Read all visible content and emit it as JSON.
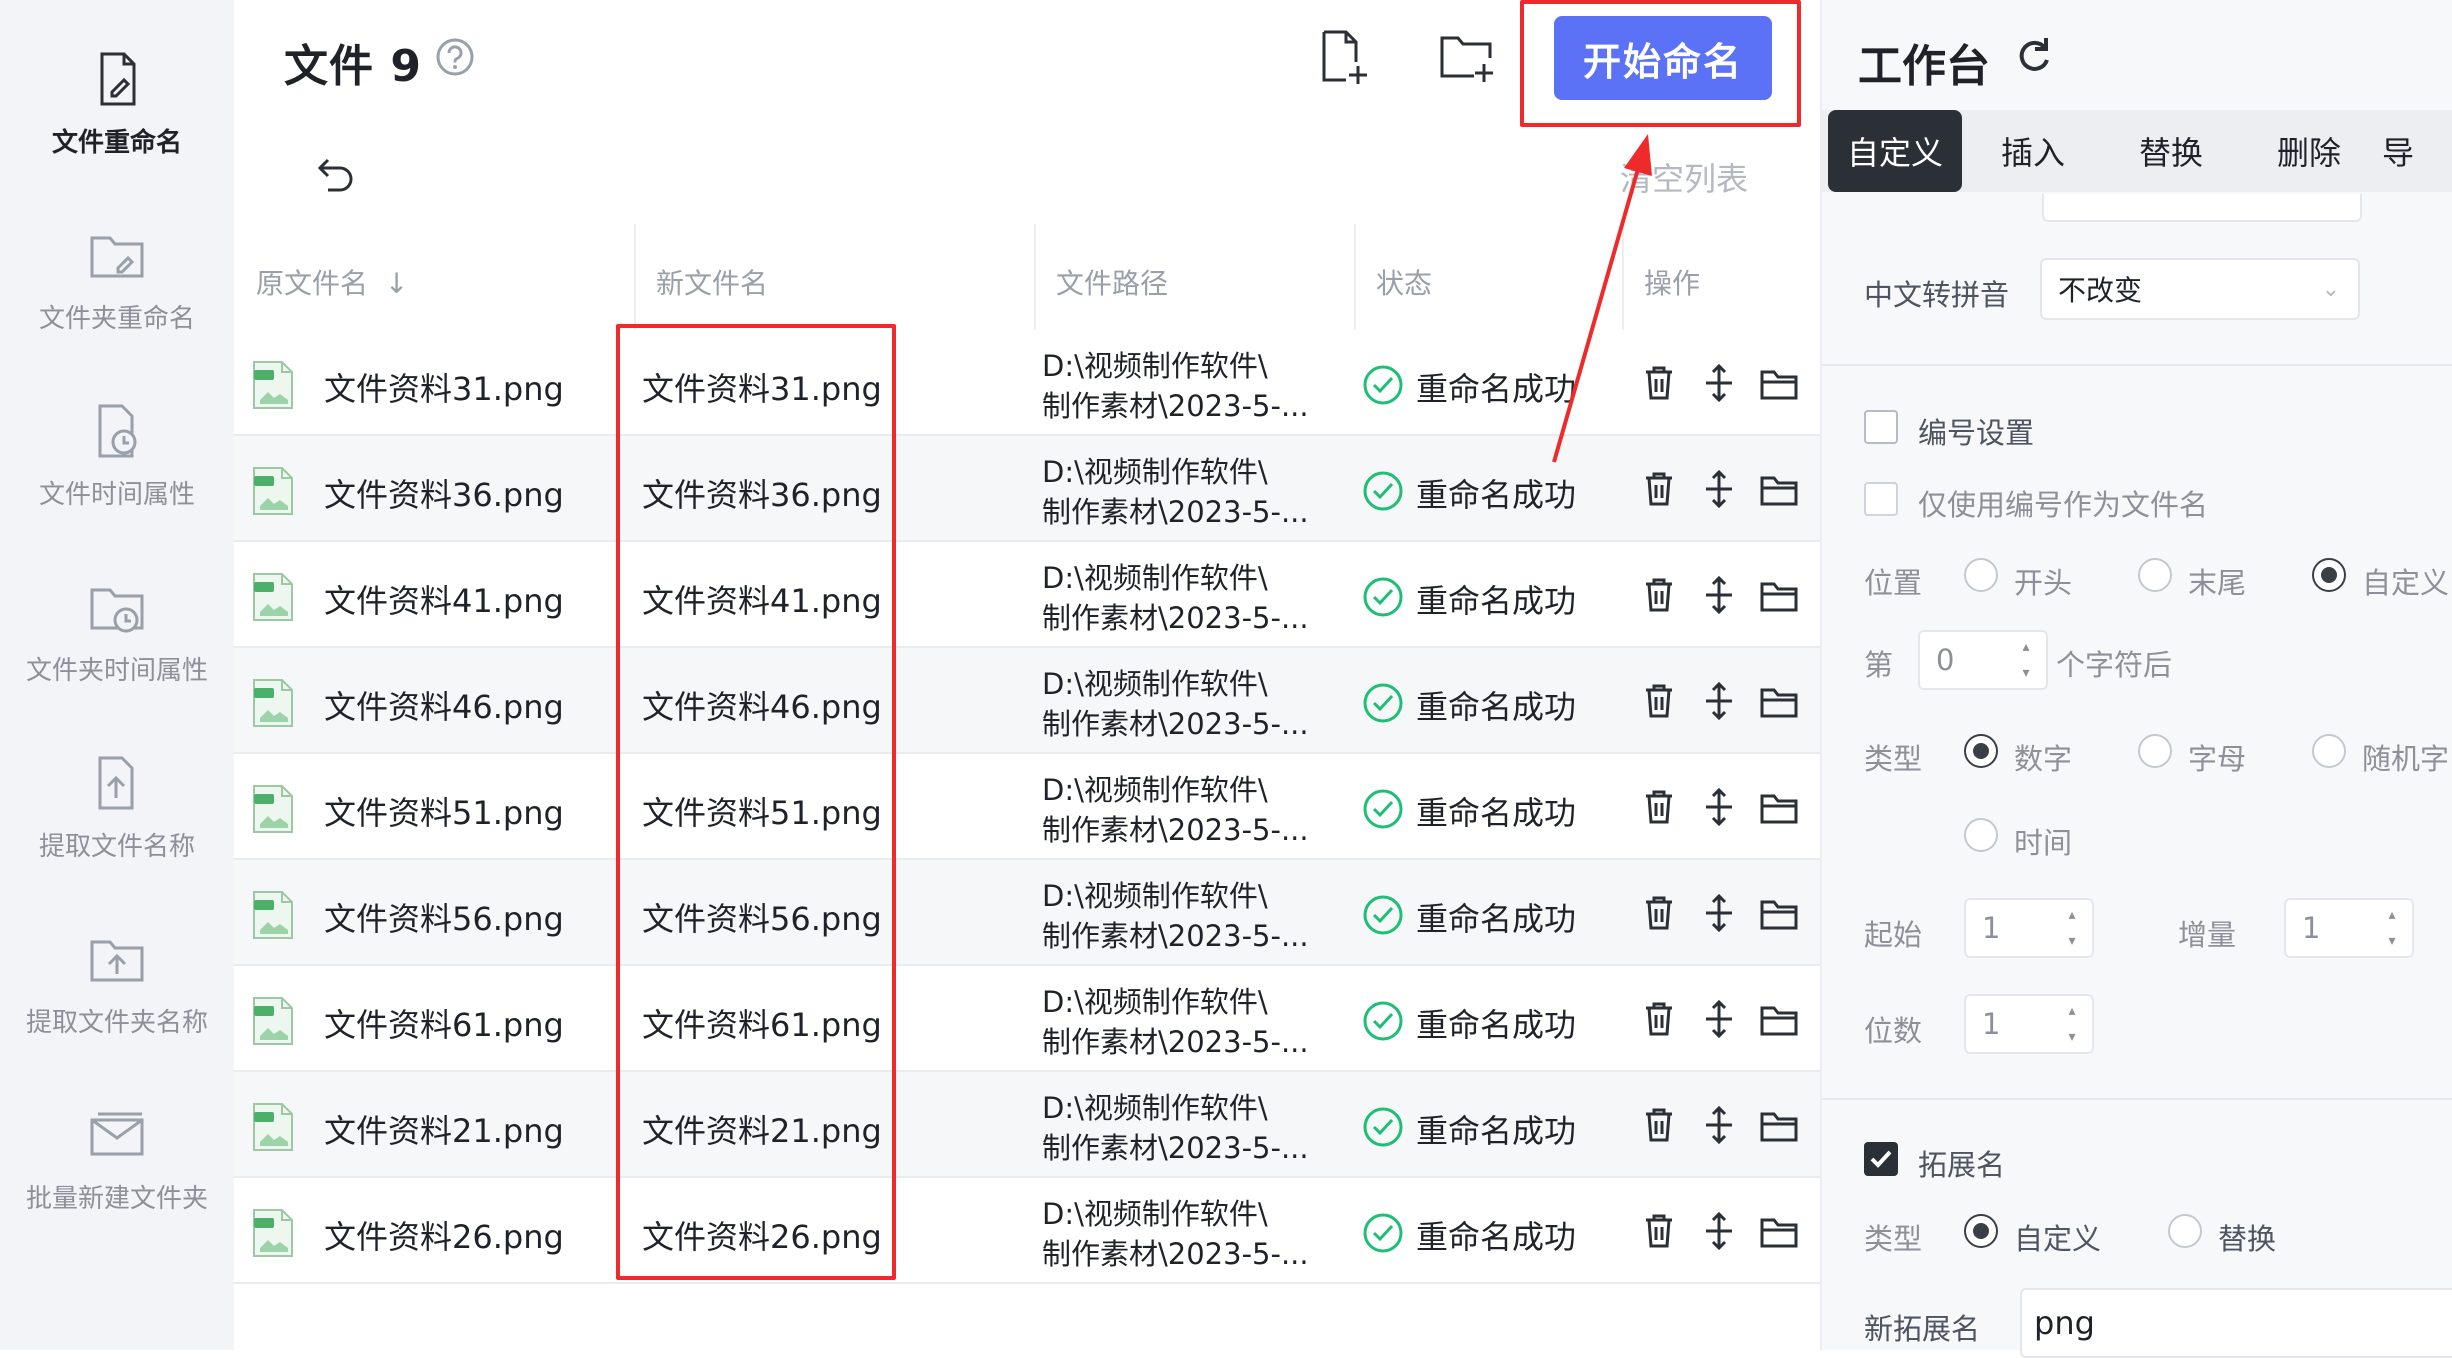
{
  "sidebar": {
    "items": [
      {
        "label": "文件重命名",
        "icon": "file-rename-icon",
        "active": true
      },
      {
        "label": "文件夹重命名",
        "icon": "folder-rename-icon",
        "active": false
      },
      {
        "label": "文件时间属性",
        "icon": "file-time-icon",
        "active": false
      },
      {
        "label": "文件夹时间属性",
        "icon": "folder-time-icon",
        "active": false
      },
      {
        "label": "提取文件名称",
        "icon": "extract-file-name-icon",
        "active": false
      },
      {
        "label": "提取文件夹名称",
        "icon": "extract-folder-name-icon",
        "active": false
      },
      {
        "label": "批量新建文件夹",
        "icon": "batch-new-folder-icon",
        "active": false
      }
    ]
  },
  "header": {
    "title": "文件 9",
    "start_button": "开始命名",
    "clear_list": "清空列表"
  },
  "table": {
    "columns": [
      "原文件名",
      "新文件名",
      "文件路径",
      "状态",
      "操作"
    ],
    "rows": [
      {
        "original": "文件资料31.png",
        "new_name": "文件资料31.png",
        "path_line1": "D:\\视频制作软件\\",
        "path_line2": "制作素材\\2023-5-...",
        "status": "重命名成功"
      },
      {
        "original": "文件资料36.png",
        "new_name": "文件资料36.png",
        "path_line1": "D:\\视频制作软件\\",
        "path_line2": "制作素材\\2023-5-...",
        "status": "重命名成功"
      },
      {
        "original": "文件资料41.png",
        "new_name": "文件资料41.png",
        "path_line1": "D:\\视频制作软件\\",
        "path_line2": "制作素材\\2023-5-...",
        "status": "重命名成功"
      },
      {
        "original": "文件资料46.png",
        "new_name": "文件资料46.png",
        "path_line1": "D:\\视频制作软件\\",
        "path_line2": "制作素材\\2023-5-...",
        "status": "重命名成功"
      },
      {
        "original": "文件资料51.png",
        "new_name": "文件资料51.png",
        "path_line1": "D:\\视频制作软件\\",
        "path_line2": "制作素材\\2023-5-...",
        "status": "重命名成功"
      },
      {
        "original": "文件资料56.png",
        "new_name": "文件资料56.png",
        "path_line1": "D:\\视频制作软件\\",
        "path_line2": "制作素材\\2023-5-...",
        "status": "重命名成功"
      },
      {
        "original": "文件资料61.png",
        "new_name": "文件资料61.png",
        "path_line1": "D:\\视频制作软件\\",
        "path_line2": "制作素材\\2023-5-...",
        "status": "重命名成功"
      },
      {
        "original": "文件资料21.png",
        "new_name": "文件资料21.png",
        "path_line1": "D:\\视频制作软件\\",
        "path_line2": "制作素材\\2023-5-...",
        "status": "重命名成功"
      },
      {
        "original": "文件资料26.png",
        "new_name": "文件资料26.png",
        "path_line1": "D:\\视频制作软件\\",
        "path_line2": "制作素材\\2023-5-...",
        "status": "重命名成功"
      }
    ]
  },
  "panel": {
    "title": "工作台",
    "tabs": [
      "自定义",
      "插入",
      "替换",
      "删除",
      "导"
    ],
    "pinyin_label": "中文转拼音",
    "pinyin_value": "不改变",
    "numbering_label": "编号设置",
    "numbering_only_label": "仅使用编号作为文件名",
    "position_label": "位置",
    "position_options": [
      "开头",
      "末尾",
      "自定义"
    ],
    "nth_label": "第",
    "nth_value": "0",
    "nth_suffix": "个字符后",
    "type_label": "类型",
    "type_options": [
      "数字",
      "字母",
      "随机字",
      "时间"
    ],
    "start_label": "起始",
    "start_value": "1",
    "increment_label": "增量",
    "increment_value": "1",
    "digits_label": "位数",
    "digits_value": "1",
    "extension_label": "拓展名",
    "ext_type_label": "类型",
    "ext_type_options": [
      "自定义",
      "替换"
    ],
    "new_ext_label": "新拓展名",
    "new_ext_value": "png"
  },
  "colors": {
    "primary": "#5b72f6",
    "success": "#1cbf73",
    "highlight": "#ee2a2a",
    "dark": "#2b2f36"
  }
}
